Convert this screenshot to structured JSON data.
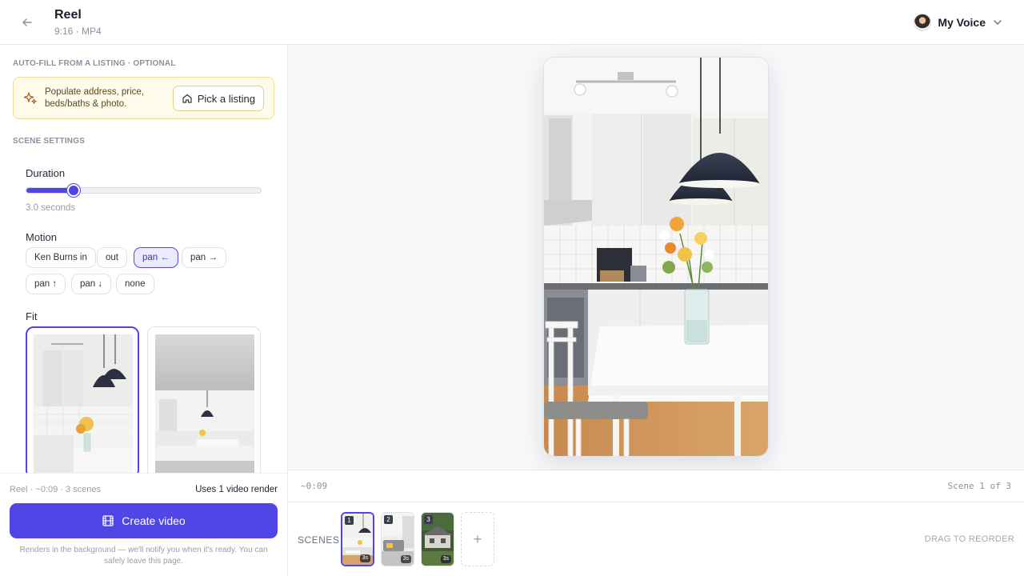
{
  "header": {
    "title": "Reel",
    "subtitle": "9:16 · MP4",
    "voice_label": "My Voice"
  },
  "left": {
    "autofill_label": "AUTO-FILL FROM A LISTING · OPTIONAL",
    "autofill_text": "Populate address, price, beds/baths & photo.",
    "pick_listing": "Pick a listing",
    "scene_settings_label": "SCENE SETTINGS",
    "duration_label": "Duration",
    "duration_value": "3.0 seconds",
    "duration_fraction": 0.2,
    "motion_label": "Motion",
    "motion_options": [
      "Ken Burns in",
      "out",
      "pan ←",
      "pan →",
      "pan ↑",
      "pan ↓",
      "none"
    ],
    "motion_selected": "pan ←",
    "fit_label": "Fit"
  },
  "footer": {
    "meta": "Reel · ~0:09 · 3 scenes",
    "render_note": "Uses 1 video render",
    "create_button": "Create video",
    "background_note": "Renders in the background — we'll notify you when it's ready. You can safely leave this page."
  },
  "preview": {
    "time_code": "~0:09",
    "scene_count": "Scene 1 of 3"
  },
  "scenes": {
    "label": "SCENES",
    "items": [
      {
        "num": "1",
        "duration": "3s"
      },
      {
        "num": "2",
        "duration": "3s"
      },
      {
        "num": "3",
        "duration": "3s"
      }
    ],
    "add_label": "+",
    "drag_hint": "DRAG TO REORDER"
  },
  "colors": {
    "accent": "#4f46e5",
    "autofill_bg": "#fffbea",
    "autofill_border": "#f3dd9c"
  }
}
